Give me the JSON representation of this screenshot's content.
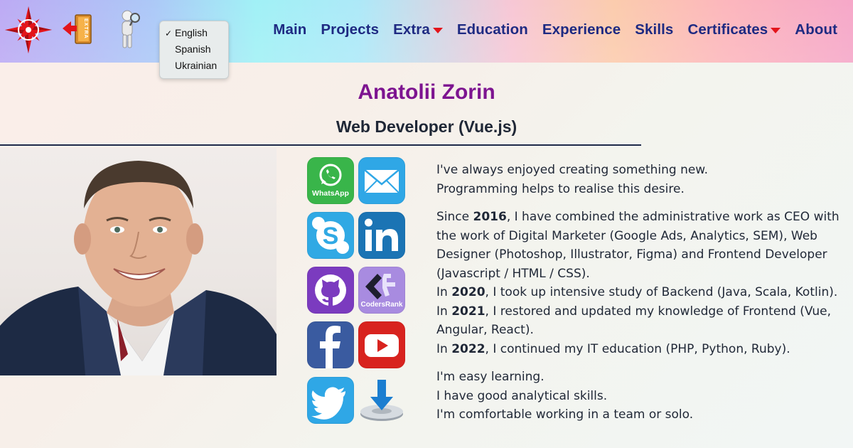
{
  "header": {
    "language_menu": {
      "selected": "English",
      "items": [
        "English",
        "Spanish",
        "Ukrainian"
      ]
    },
    "extra_logo_text": "EXTRA",
    "nav": [
      {
        "label": "Main",
        "dropdown": false
      },
      {
        "label": "Projects",
        "dropdown": false
      },
      {
        "label": "Extra",
        "dropdown": true
      },
      {
        "label": "Education",
        "dropdown": false
      },
      {
        "label": "Experience",
        "dropdown": false
      },
      {
        "label": "Skills",
        "dropdown": false
      },
      {
        "label": "Certificates",
        "dropdown": true
      },
      {
        "label": "About",
        "dropdown": false
      }
    ]
  },
  "profile": {
    "name": "Anatolii Zorin",
    "role": "Web Developer (Vue.js)"
  },
  "social": {
    "whatsapp_label": "WhatsApp",
    "codersrank_label": "CodersRank"
  },
  "bio": {
    "intro": [
      "I've always enjoyed creating something new.",
      "Programming helps to realise this desire."
    ],
    "since_pre": "Since ",
    "since_year": "2016",
    "since_text": ", I have combined the administrative work as CEO with the work of Digital Marketer (Google Ads, Analytics, SEM), Web Designer (Photoshop, Illustrator, Figma) and Frontend Developer (Javascript / HTML / CSS).",
    "y2020_pre": "In ",
    "y2020": "2020",
    "y2020_text": ", I took up intensive study of Backend (Java, Scala, Kotlin).",
    "y2021_pre": "In ",
    "y2021": "2021",
    "y2021_text": ", I restored and updated my knowledge of Frontend (Vue, Angular, React).",
    "y2022_pre": "In ",
    "y2022": "2022",
    "y2022_text": ", I continued my IT education (PHP, Python, Ruby).",
    "closing": [
      "I'm easy learning.",
      "I have good analytical skills.",
      "I'm comfortable working in a team or solo."
    ]
  },
  "colors": {
    "nav_text": "#1e2a82",
    "name": "#7d1490",
    "caret": "#e3151b"
  }
}
